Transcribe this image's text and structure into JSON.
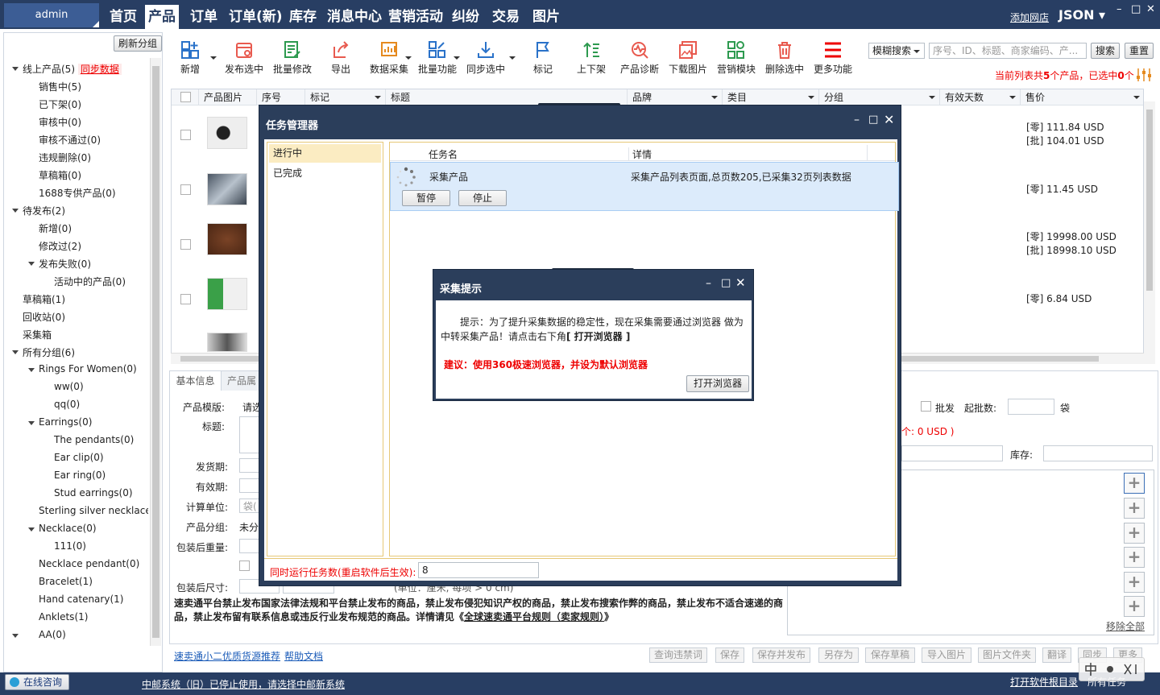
{
  "topbar": {
    "user": "admin",
    "nav": [
      "首页",
      "产品",
      "订单",
      "订单(新)",
      "库存",
      "消息中心",
      "营销活动",
      "纠纷",
      "交易",
      "图片"
    ],
    "add_shop": "添加网店",
    "account": "JSON ▾",
    "win_controls": [
      "–",
      "□",
      "✕"
    ]
  },
  "sidebar": {
    "refresh": "刷新分组",
    "tree": {
      "online": "线上产品(5)",
      "sync": "同步数据",
      "items": [
        "销售中(5)",
        "已下架(0)",
        "审核中(0)",
        "审核不通过(0)",
        "违规删除(0)",
        "草稿箱(0)",
        "1688专供产品(0)"
      ],
      "pending": "待发布(2)",
      "pending_items": [
        "新增(0)",
        "修改过(2)"
      ],
      "failed": "发布失败(0)",
      "active": "活动中的产品(0)",
      "drafts": "草稿箱(1)",
      "recycle": "回收站(0)",
      "collect": "采集箱",
      "groups": "所有分组(6)",
      "rings": "Rings For Women(0)",
      "ww": "ww(0)",
      "qq": "qq(0)",
      "earrings": "Earrings(0)",
      "pendants": "The pendants(0)",
      "clip": "Ear clip(0)",
      "ear_ring": "Ear ring(0)",
      "stud": "Stud earrings(0)",
      "sterling": "Sterling silver necklace(",
      "necklace": "Necklace(0)",
      "n111": "111(0)",
      "neck_pend": "Necklace pendant(0)",
      "bracelet": "Bracelet(1)",
      "hand": "Hand catenary(1)",
      "anklets": "Anklets(1)",
      "aa": "AA(0)"
    }
  },
  "toolbar": {
    "buttons": [
      "新增",
      "发布选中",
      "批量修改",
      "导出",
      "数据采集",
      "批量功能",
      "同步选中",
      "标记",
      "上下架",
      "产品诊断",
      "下载图片",
      "营销模块",
      "删除选中",
      "更多功能"
    ],
    "search_mode": "模糊搜索",
    "search_placeholder": "序号、ID、标题、商家编码、产...",
    "search": "搜索",
    "reset": "重置",
    "count_prefix": "当前列表共",
    "count_total": "5",
    "count_mid": "个产品，已选中",
    "count_sel": "0",
    "count_suffix": "个"
  },
  "grid": {
    "headers": [
      "产品图片",
      "序号",
      "标记",
      "标题",
      "品牌",
      "类目",
      "分组",
      "有效天数",
      "售价"
    ],
    "prices": [
      [
        "[零] 111.84 USD",
        "[批] 104.01 USD"
      ],
      [
        "[零] 11.45 USD",
        ""
      ],
      [
        "[零] 19998.00 USD",
        "[批] 18998.10 USD"
      ],
      [
        "[零] 6.84 USD",
        ""
      ]
    ]
  },
  "detail": {
    "tabs": [
      "基本信息",
      "产品属"
    ],
    "labels": [
      "产品模版:",
      "标题:",
      "发货期:",
      "有效期:",
      "计算单位:",
      "产品分组:",
      "包装后重量:",
      "包装后尺寸:"
    ],
    "template_val": "请选",
    "unit_val": "袋(",
    "group_val": "未分",
    "wholesale": "批发",
    "min_batch": "起批数:",
    "bag": "袋",
    "price_info": "个: 0 USD )",
    "stock": "库存:",
    "remove_all": "移除全部",
    "size_hint": "(单位：厘米, 每项 > 0 cm)",
    "notice_a": "速卖通平台禁止发布国家法律法规和平台禁止发布的商品，禁止发布侵犯知识产权的商品，禁止发布搜索作弊的商品，禁止发布不适合速递的商品，禁止发布留有联系信息或违反行业发布规范的商品。详情请见《",
    "notice_link": "全球速卖通平台规则（卖家规则）",
    "notice_b": "》"
  },
  "bottom": {
    "link1": "速卖通小二优质货源推荐",
    "link2": "帮助文档",
    "buttons": [
      "查询违禁词",
      "保存",
      "保存并发布",
      "另存为",
      "保存草稿",
      "导入图片",
      "图片文件夹",
      "翻译",
      "同步",
      "更多"
    ]
  },
  "status": {
    "consult": "在线咨询",
    "msg": "中邮系统（旧）已停止使用，请选择中邮新系统",
    "log": "打开软件根目录",
    "tasks": "所有任务"
  },
  "task_manager": {
    "title": "任务管理器",
    "tabs": [
      "进行中",
      "已完成"
    ],
    "col_name": "任务名",
    "col_detail": "详情",
    "task_name": "采集产品",
    "task_detail": "采集产品列表页面,总页数205,已采集32页列表数据",
    "pause": "暂停",
    "stop": "停止",
    "concurrent_label": "同时运行任务数(重启软件后生效):",
    "concurrent_val": "8"
  },
  "collect_prompt": {
    "title": "采集提示",
    "msg_a": "提示：为了提升采集数据的稳定性，现在采集需要通过浏览器 做为中转采集产品！请点击右下角",
    "msg_b": "[ 打开浏览器 ]",
    "suggest": "建议：使用360极速浏览器，并设为默认浏览器",
    "open": "打开浏览器"
  },
  "colors": {
    "navbar": "#283e63",
    "accent_red": "#e00000",
    "dialog": "#2b3e5b",
    "tab_border": "#e6c877"
  }
}
